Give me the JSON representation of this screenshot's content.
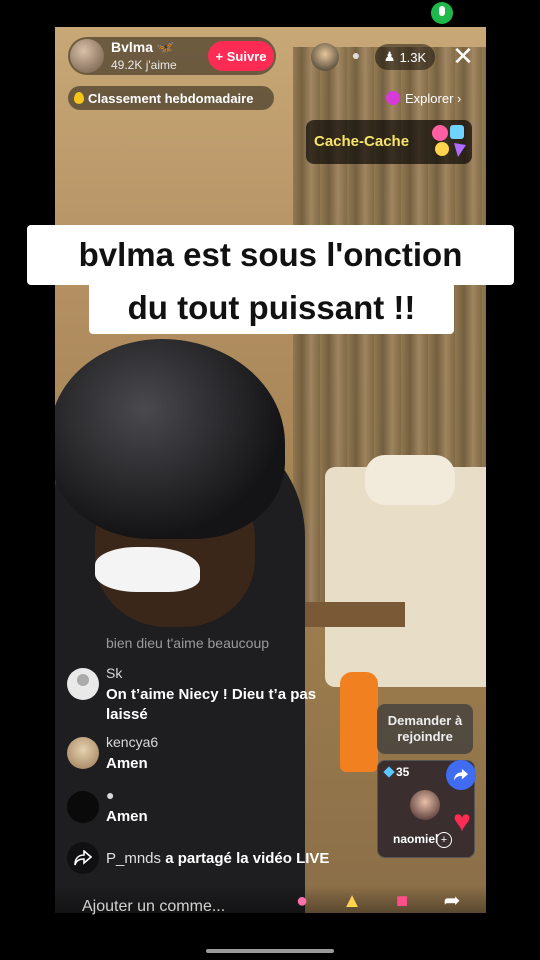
{
  "status": {
    "mic_icon": "mic-icon"
  },
  "host": {
    "name": "Bvlma 🦋",
    "likes": "49.2K j'aime",
    "follow_label": "+ Suivre"
  },
  "viewers": {
    "count": "1.3K"
  },
  "weekly_rank": {
    "label": "Classement hebdomadaire"
  },
  "explore": {
    "label": "Explorer ›"
  },
  "game": {
    "label": "Cache-Cache"
  },
  "banner": {
    "line1": "bvlma est sous l'onction",
    "line2": "du tout puissant !!"
  },
  "comments": {
    "faded": "bien dieu t'aime beaucoup",
    "items": [
      {
        "user": "Sk",
        "text": "On t’aime Niecy ! Dieu t’a pas laissé"
      },
      {
        "user": "kencya6",
        "text": "Amen"
      },
      {
        "user": "",
        "text": "Amen"
      }
    ]
  },
  "share_event": {
    "user": "P_mnds",
    "text": "a partagé la vidéo LIVE"
  },
  "join": {
    "label": "Demander à rejoindre"
  },
  "guest": {
    "count": "35",
    "name": "naomiel"
  },
  "bottom": {
    "comment_placeholder": "Ajouter un comme..."
  },
  "colors": {
    "follow": "#fe2c55",
    "heart": "#fe2c55",
    "share": "#3f6cf0",
    "mic": "#1fb84a"
  }
}
